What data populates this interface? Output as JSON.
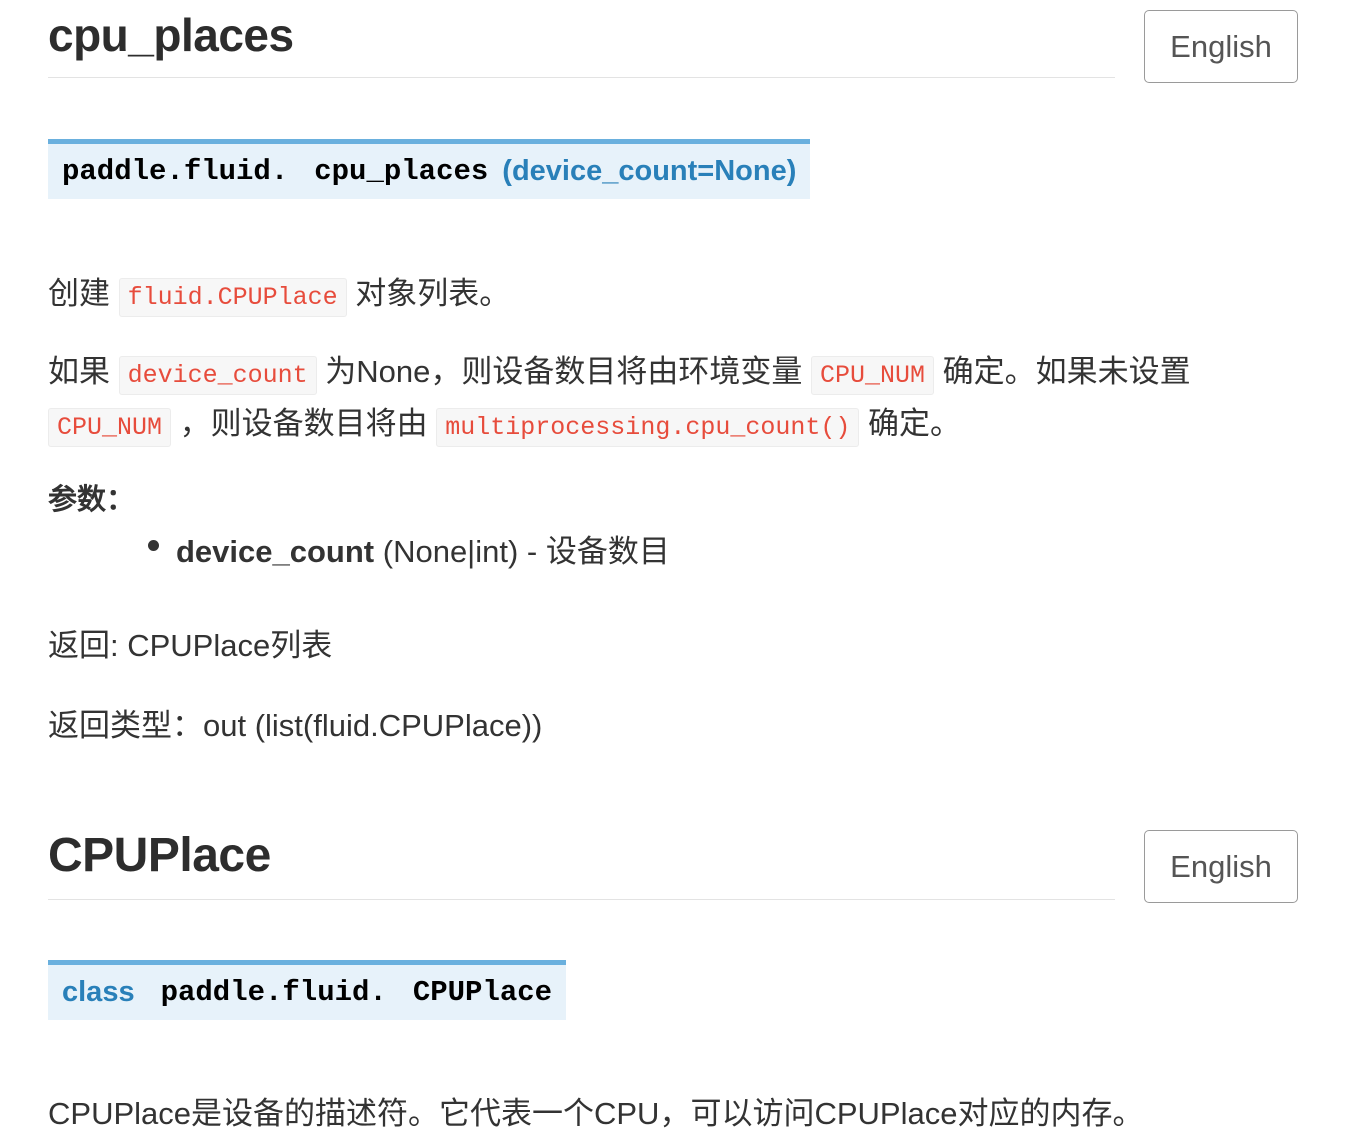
{
  "section1": {
    "title": "cpu_places",
    "lang_button": "English",
    "signature": {
      "module": "paddle.fluid.",
      "name": "cpu_places",
      "params": "(device_count=None)"
    },
    "desc": {
      "part1": "创建",
      "code1": "fluid.CPUPlace",
      "part2": "对象列表。"
    },
    "detail": {
      "part1": "如果",
      "code1": "device_count",
      "part2": "为None，则设备数目将由环境变量",
      "code2": "CPU_NUM",
      "part3": "确定。如果未设置",
      "code3": "CPU_NUM",
      "part4": "，则设备数目将由",
      "code4": "multiprocessing.cpu_count()",
      "part5": "确定。"
    },
    "params_label": "参数：",
    "params": [
      {
        "name": "device_count",
        "desc": "(None|int) - 设备数目"
      }
    ],
    "returns": "返回: CPUPlace列表",
    "return_type": "返回类型：out (list(fluid.CPUPlace))"
  },
  "section2": {
    "title": "CPUPlace",
    "lang_button": "English",
    "signature": {
      "keyword": "class",
      "module": "paddle.fluid.",
      "name": "CPUPlace"
    },
    "desc": "CPUPlace是设备的描述符。它代表一个CPU，可以访问CPUPlace对应的内存。"
  }
}
